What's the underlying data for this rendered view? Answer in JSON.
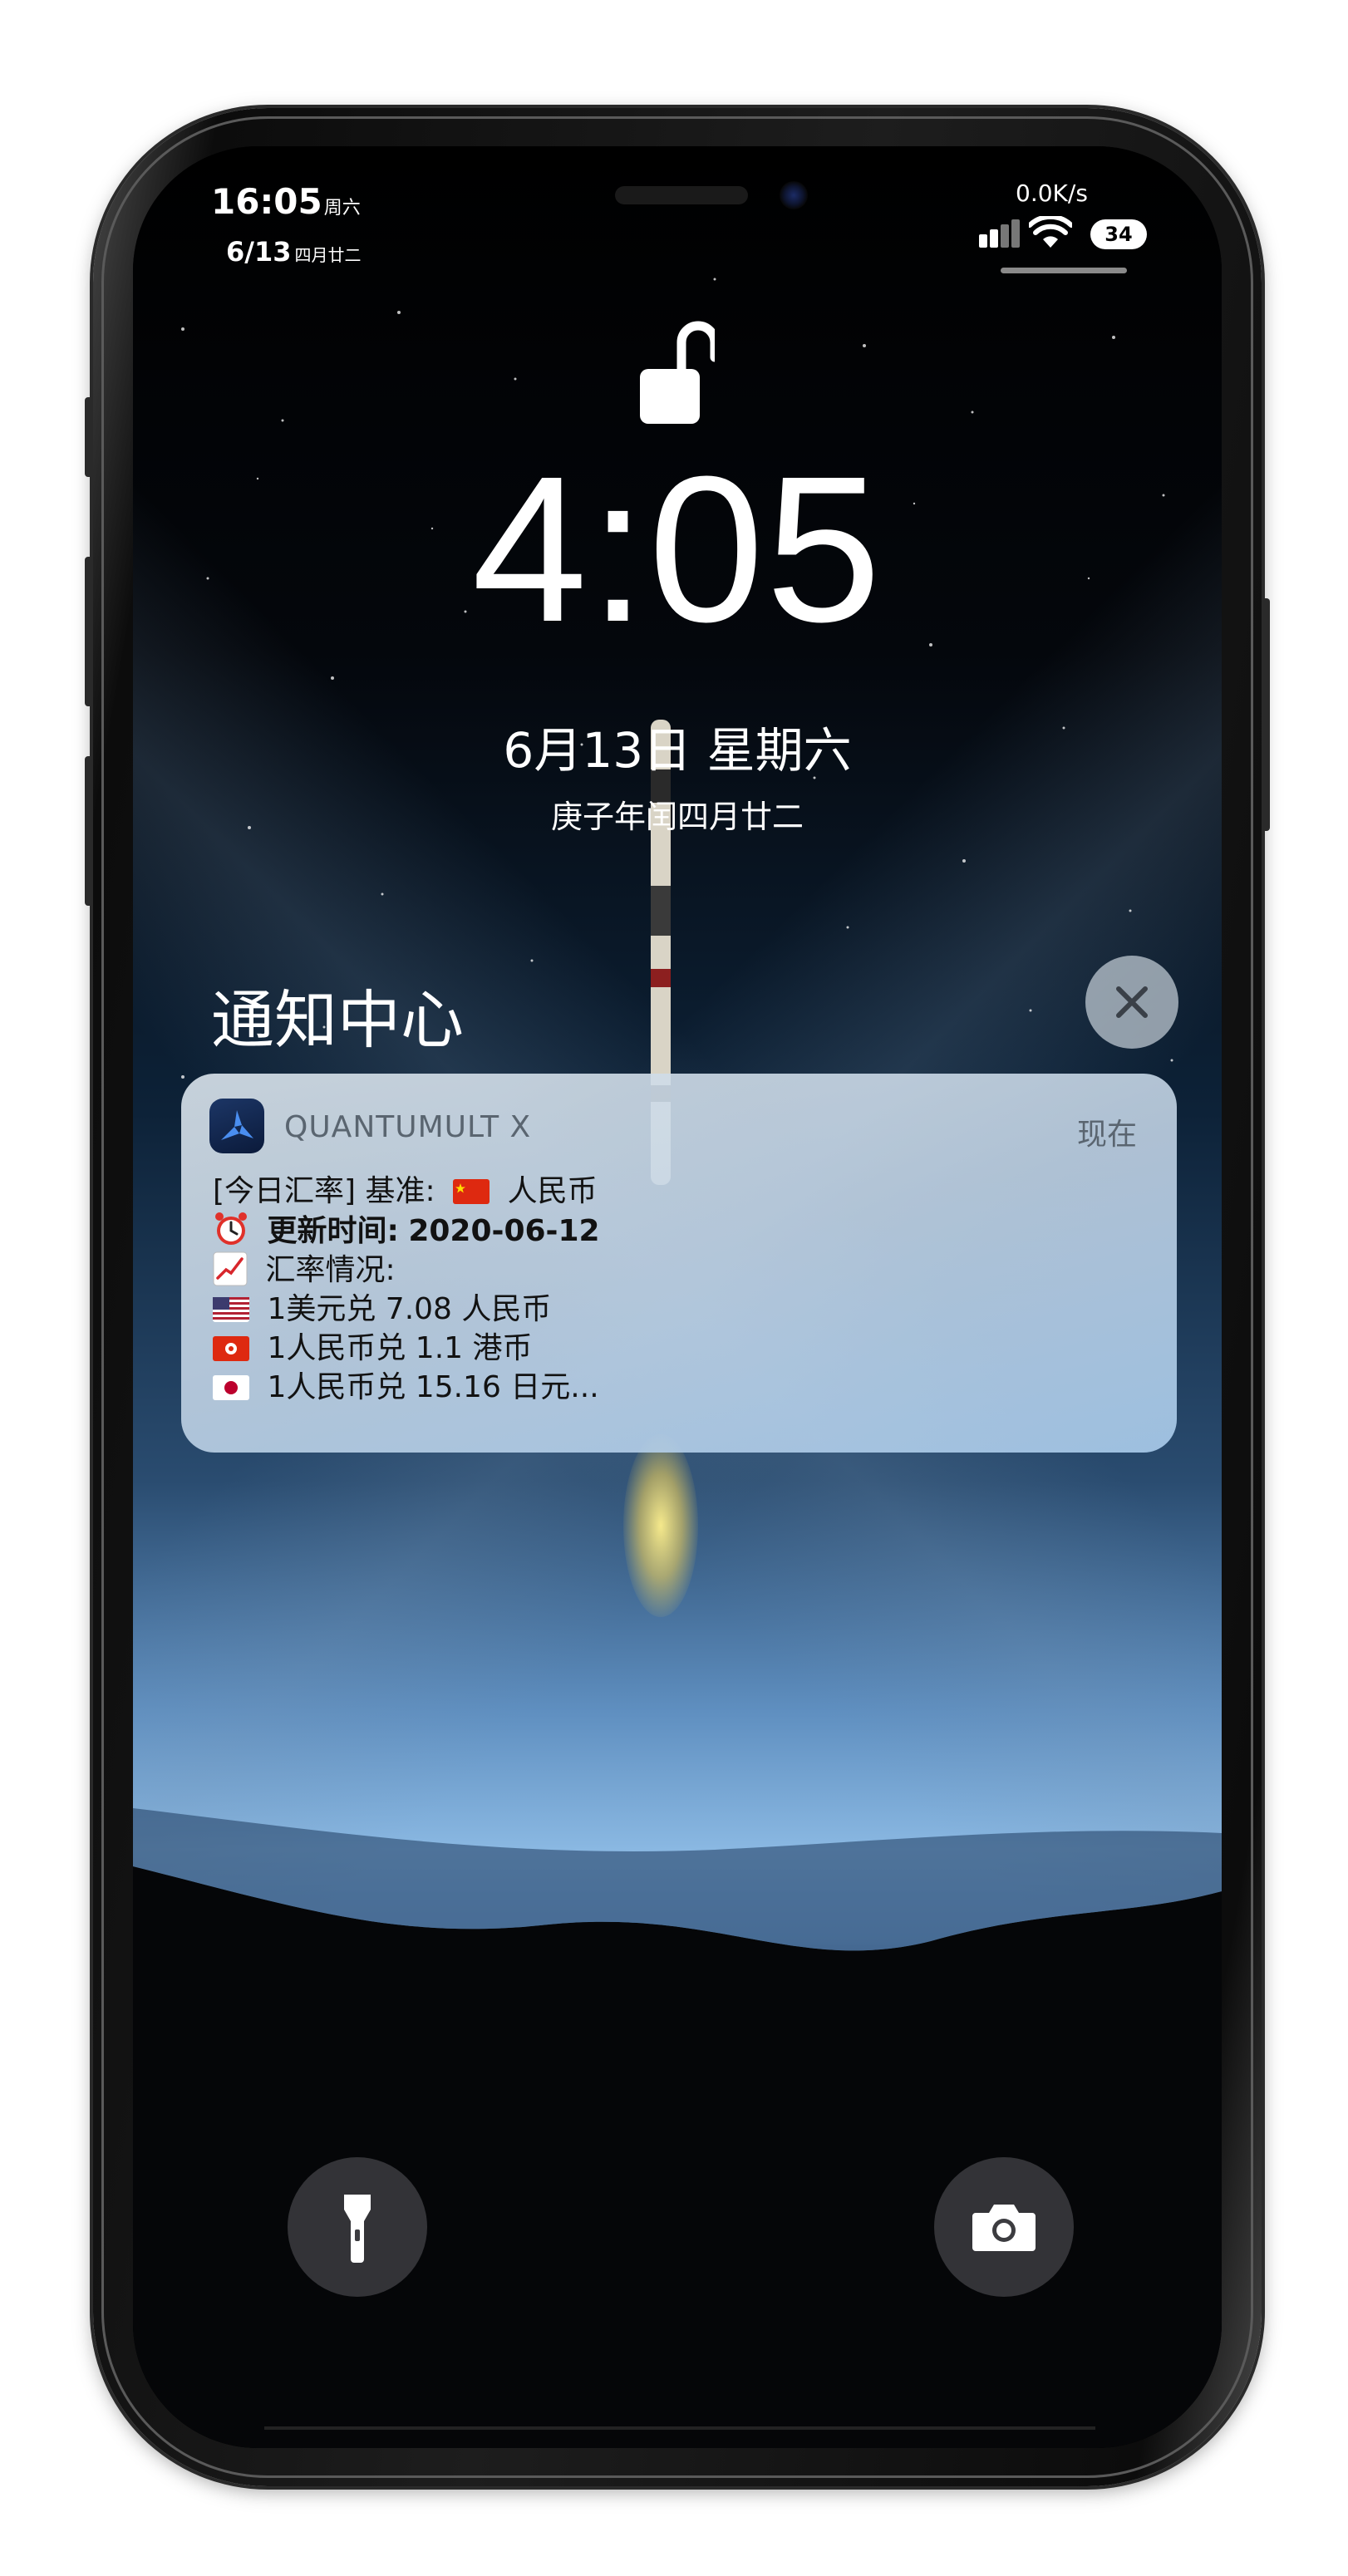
{
  "status_bar": {
    "time": "16:05",
    "weekday": "周六",
    "date": "6/13",
    "lunar_short": "四月廿二",
    "net_speed": "0.0K/s",
    "battery_level": "34",
    "icons": [
      "signal-icon",
      "wifi-icon",
      "battery-icon"
    ]
  },
  "lock_screen": {
    "time": "4:05",
    "date": "6月13日 星期六",
    "lunar_date": "庚子年闰四月廿二",
    "lock_icon": "unlocked-padlock-icon"
  },
  "notification_center": {
    "title": "通知中心",
    "close_icon": "close-icon"
  },
  "notification": {
    "app_name": "QUANTUMULT X",
    "time": "现在",
    "lines": [
      {
        "prefix": "[今日汇率] 基准:",
        "flag": "cn",
        "text": "人民币"
      },
      {
        "emoji": "alarm-clock",
        "label": "更新时间:",
        "value": "2020-06-12"
      },
      {
        "emoji": "chart-increasing",
        "text": "汇率情况:"
      },
      {
        "flag": "us",
        "text": "1美元兑 7.08 人民币"
      },
      {
        "flag": "hk",
        "text": "1人民币兑 1.1 港币"
      },
      {
        "flag": "jp",
        "text": "1人民币兑 15.16 日元..."
      }
    ]
  },
  "quick_actions": {
    "left": "flashlight-icon",
    "right": "camera-icon"
  },
  "colors": {
    "accent_blue": "#8ab8e2",
    "notif_bg": "#c4d6e8",
    "button_bg": "#3c3c40"
  }
}
